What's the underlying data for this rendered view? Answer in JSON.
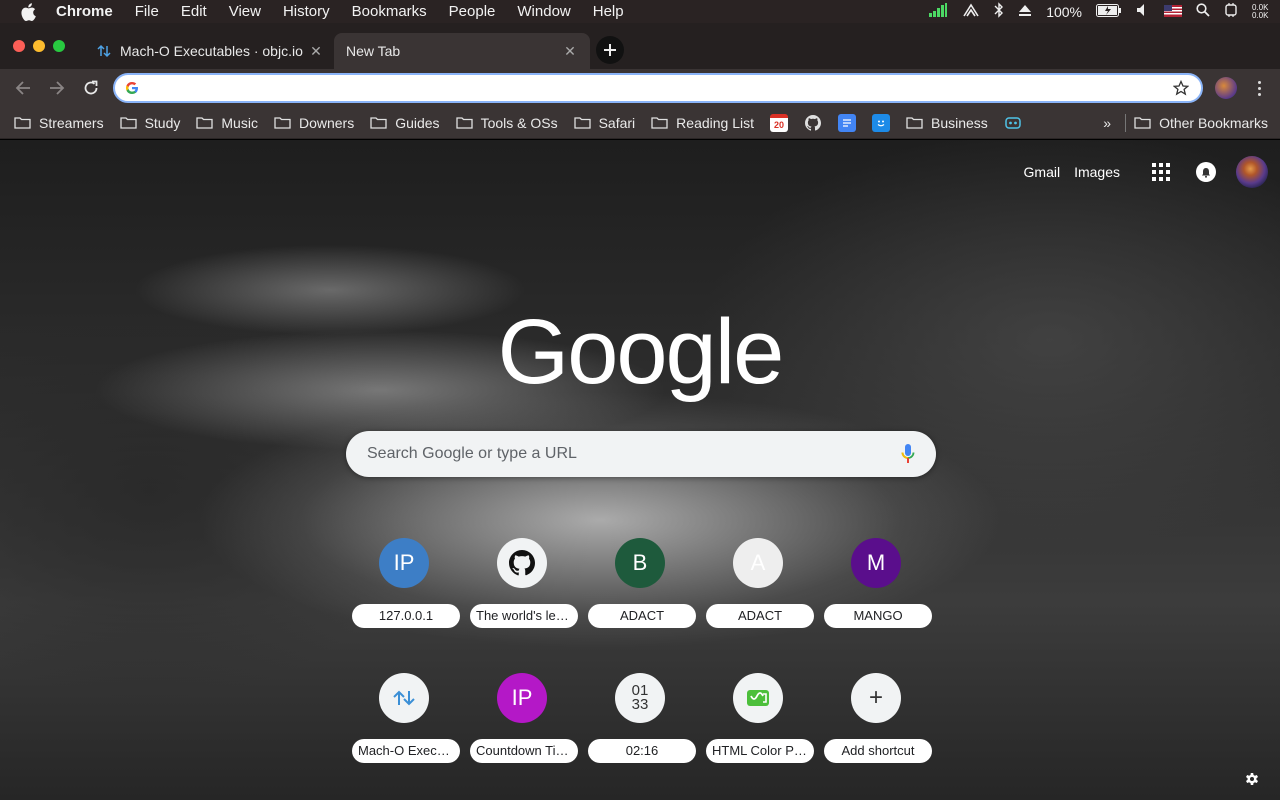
{
  "menubar": {
    "app_name": "Chrome",
    "items": [
      "File",
      "Edit",
      "View",
      "History",
      "Bookmarks",
      "People",
      "Window",
      "Help"
    ],
    "battery": "100%",
    "net_up": "0.0K",
    "net_down": "0.0K"
  },
  "tabs": [
    {
      "title": "Mach-O Executables · objc.io",
      "active": false
    },
    {
      "title": "New Tab",
      "active": true
    }
  ],
  "toolbar": {
    "url_value": ""
  },
  "bookmarks": {
    "folders": [
      "Streamers",
      "Study",
      "Music",
      "Downers",
      "Guides",
      "Tools & OSs",
      "Safari",
      "Reading List"
    ],
    "business": "Business",
    "overflow": "»",
    "other": "Other Bookmarks",
    "cal_badge": "20"
  },
  "ntp": {
    "gmail": "Gmail",
    "images": "Images",
    "logo": "Google",
    "search_placeholder": "Search Google or type a URL",
    "shortcuts": [
      {
        "label": "127.0.0.1",
        "initial": "IP",
        "color": "#3d7ec6"
      },
      {
        "label": "The world's lea…",
        "initial": "",
        "icon": "github-icon",
        "color": "#f1f3f4"
      },
      {
        "label": "ADACT",
        "initial": "B",
        "color": "#1e5a3c"
      },
      {
        "label": "ADACT",
        "initial": "A",
        "color": "#eeeeee"
      },
      {
        "label": "MANGO",
        "initial": "M",
        "color": "#5a0e8c"
      },
      {
        "label": "Mach-O Execut…",
        "initial": "",
        "icon": "transfer-arrows-icon",
        "color": "#f1f3f4"
      },
      {
        "label": "Countdown Timer",
        "initial": "IP",
        "color": "#b418c7"
      },
      {
        "label": "02:16",
        "initial": "01\n33",
        "color": "#f1f3f4"
      },
      {
        "label": "HTML Color Pi…",
        "initial": "",
        "icon": "color-picker-icon",
        "color": "#f1f3f4"
      },
      {
        "label": "Add shortcut",
        "initial": "+",
        "color": "#f1f3f4"
      }
    ]
  }
}
